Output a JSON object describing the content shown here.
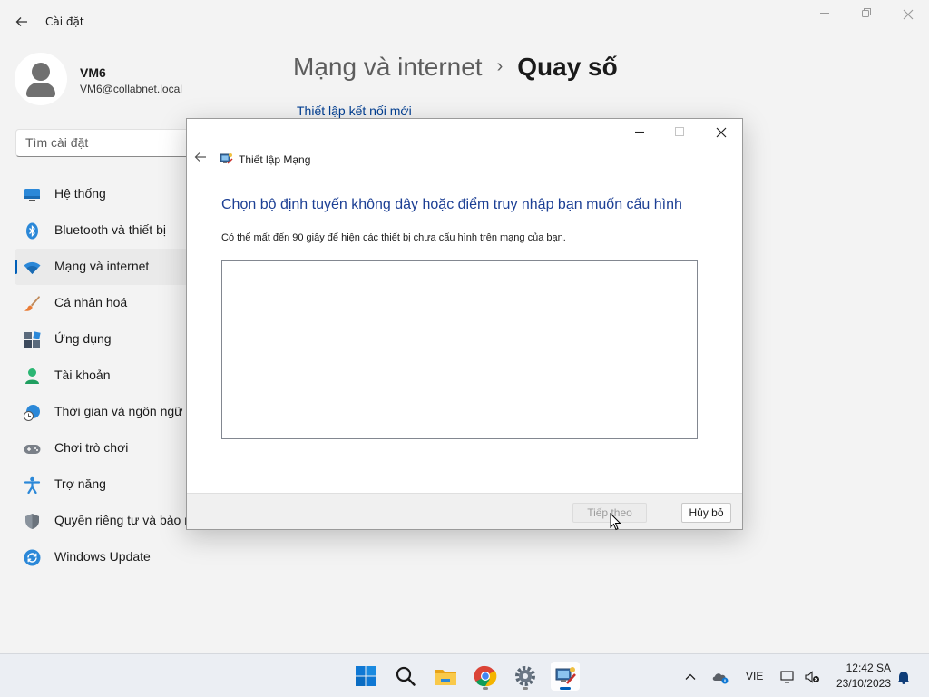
{
  "settings": {
    "app_title": "Cài đặt",
    "user": {
      "name": "VM6",
      "email": "VM6@collabnet.local"
    },
    "search_placeholder": "Tìm cài đặt",
    "nav_items": [
      {
        "label": "Hệ thống",
        "icon": "monitor-icon"
      },
      {
        "label": "Bluetooth và thiết bị",
        "icon": "bluetooth-icon"
      },
      {
        "label": "Mạng và internet",
        "icon": "wifi-icon"
      },
      {
        "label": "Cá nhân hoá",
        "icon": "paintbrush-icon"
      },
      {
        "label": "Ứng dụng",
        "icon": "apps-icon"
      },
      {
        "label": "Tài khoản",
        "icon": "person-icon"
      },
      {
        "label": "Thời gian và ngôn ngữ",
        "icon": "globe-clock-icon"
      },
      {
        "label": "Chơi trò chơi",
        "icon": "gamepad-icon"
      },
      {
        "label": "Trợ năng",
        "icon": "accessibility-icon"
      },
      {
        "label": "Quyền riêng tư và bảo mật",
        "icon": "shield-icon"
      },
      {
        "label": "Windows Update",
        "icon": "sync-icon"
      }
    ],
    "active_nav": "Mạng và internet",
    "breadcrumb_parent": "Mạng và internet",
    "breadcrumb_separator": "›",
    "breadcrumb_current": "Quay số",
    "new_connection_link": "Thiết lập kết nối mới"
  },
  "dialog": {
    "title": "Thiết lập Mạng",
    "heading": "Chọn bộ định tuyến không dây hoặc điểm truy nhập bạn muốn cấu hình",
    "description": "Có thể mất đến 90 giây để hiện các thiết bị chưa cấu hình trên mạng của bạn.",
    "next_label": "Tiếp theo",
    "next_enabled": false,
    "cancel_label": "Hủy bỏ"
  },
  "taskbar": {
    "apps": [
      "start-icon",
      "search-icon",
      "file-explorer-icon",
      "chrome-icon",
      "settings-icon",
      "network-setup-icon"
    ],
    "active_app": "network-setup-icon",
    "language": "VIE",
    "time": "12:42 SA",
    "date": "23/10/2023"
  },
  "colors": {
    "accent": "#005fb8",
    "heading_blue": "#1c3f94",
    "link_blue": "#003e92"
  }
}
